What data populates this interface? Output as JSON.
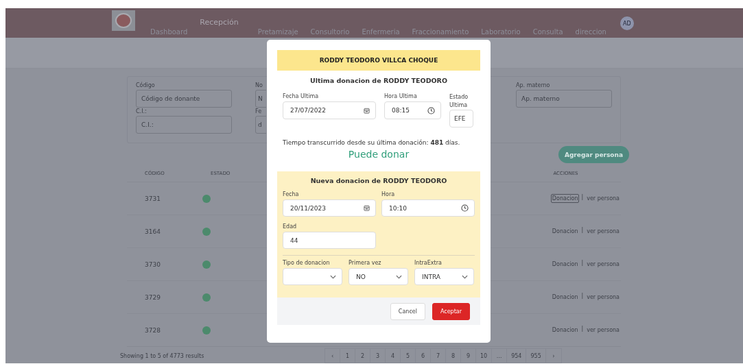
{
  "nav": {
    "items": [
      {
        "label": "Dashboard",
        "selected": false
      },
      {
        "label": "Recepción",
        "selected": true
      },
      {
        "label": "Pretamizaje",
        "selected": false
      },
      {
        "label": "Consultorio",
        "selected": false
      },
      {
        "label": "Enfermeria",
        "selected": false
      },
      {
        "label": "Fraccionamiento",
        "selected": false
      },
      {
        "label": "Laboratorio",
        "selected": false
      },
      {
        "label": "Consulta",
        "selected": false
      },
      {
        "label": "direccion",
        "selected": false
      }
    ],
    "avatar": "AD"
  },
  "filters": {
    "columns": [
      [
        {
          "label": "Código",
          "placeholder": "Código de donante"
        },
        {
          "label": "C.I.:",
          "placeholder": "C.I.:"
        }
      ],
      [
        {
          "label": "No",
          "placeholder": "N"
        },
        {
          "label": "Fe",
          "placeholder": "d"
        }
      ]
    ],
    "right": [
      {
        "label": "Ap. materno",
        "placeholder": "Ap. materno"
      }
    ]
  },
  "add_button": "Agregar persona",
  "table": {
    "columns": [
      {
        "label": "CÓDIGO"
      },
      {
        "label": "ESTADO"
      },
      {
        "label": "ACCIONES"
      }
    ],
    "rows": [
      {
        "code": "3731",
        "active": true,
        "actions": [
          "Donacion",
          "ver persona"
        ],
        "focused": true
      },
      {
        "code": "3164",
        "active": true,
        "actions": [
          "Donacion",
          "ver persona"
        ],
        "focused": false
      },
      {
        "code": "3730",
        "active": true,
        "actions": [
          "Donacion",
          "ver persona"
        ],
        "focused": false
      },
      {
        "code": "3729",
        "active": true,
        "actions": [
          "Donacion",
          "ver persona"
        ],
        "focused": false
      },
      {
        "code": "3728",
        "active": true,
        "actions": [
          "Donacion",
          "ver persona"
        ],
        "focused": false
      }
    ],
    "separator": "|"
  },
  "pagination": {
    "summary": "Showing 1 to 5 of 4773 results",
    "prev": "‹",
    "pages": [
      "1",
      "2",
      "3",
      "4",
      "5",
      "6",
      "7",
      "8",
      "9",
      "10",
      "...",
      "954",
      "955"
    ],
    "next": "›"
  },
  "modal": {
    "name": "RODDY TEODORO VILLCA CHOQUE",
    "last_title": "Ultima donacion de RODDY TEODORO",
    "last_fields": [
      {
        "label": "Fecha Ultima",
        "value": "27/07/2022",
        "kind": "date"
      },
      {
        "label": "Hora Ultima",
        "value": "08:15",
        "kind": "time"
      },
      {
        "label": "Estado Ultima",
        "value": "EFE",
        "kind": "text"
      }
    ],
    "elapsed": "Tiempo transcurrido desde su última donación: **481** días.",
    "verdict": "Puede donar",
    "new_title": "Nueva donacion de RODDY TEODORO",
    "new_fields": [
      {
        "label": "Fecha",
        "value": "20/11/2023",
        "kind": "date"
      },
      {
        "label": "Hora",
        "value": "10:10",
        "kind": "time"
      },
      {
        "label": "Edad",
        "value": "44",
        "kind": "text"
      }
    ],
    "selects": [
      {
        "label": "Tipo de donacion"
      },
      {
        "label": "Primera vez",
        "value": "NO"
      },
      {
        "label": "IntraExtra",
        "value": "INTRA"
      }
    ],
    "buttons": [
      {
        "label": "Cancel",
        "kind": "secondary"
      },
      {
        "label": "Aceptar",
        "kind": "primary"
      }
    ]
  }
}
